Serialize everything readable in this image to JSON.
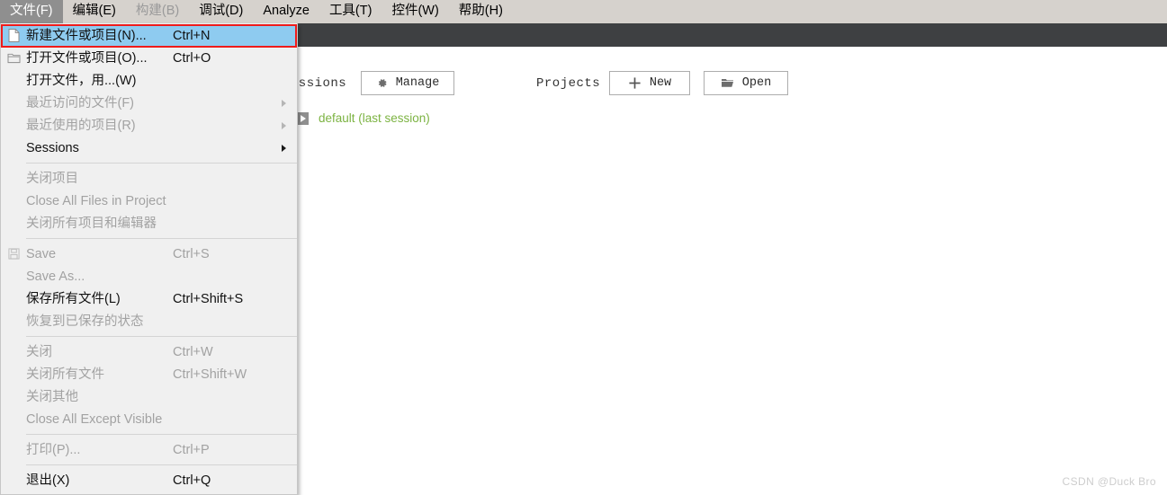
{
  "menubar": {
    "items": [
      {
        "label": "文件(F)",
        "state": "active"
      },
      {
        "label": "编辑(E)",
        "state": "normal"
      },
      {
        "label": "构建(B)",
        "state": "disabled"
      },
      {
        "label": "调试(D)",
        "state": "normal"
      },
      {
        "label": "Analyze",
        "state": "normal"
      },
      {
        "label": "工具(T)",
        "state": "normal"
      },
      {
        "label": "控件(W)",
        "state": "normal"
      },
      {
        "label": "帮助(H)",
        "state": "normal"
      }
    ]
  },
  "file_menu": {
    "groups": [
      {
        "rows": [
          {
            "icon": "new-file-icon",
            "label": "新建文件或项目(N)...",
            "shortcut": "Ctrl+N",
            "disabled": false,
            "selected": true,
            "submenu": false
          },
          {
            "icon": "open-folder-icon",
            "label": "打开文件或项目(O)...",
            "shortcut": "Ctrl+O",
            "disabled": false,
            "selected": false,
            "submenu": false
          },
          {
            "icon": "",
            "label": "打开文件，用...(W)",
            "shortcut": "",
            "disabled": false,
            "selected": false,
            "submenu": false
          },
          {
            "icon": "",
            "label": "最近访问的文件(F)",
            "shortcut": "",
            "disabled": true,
            "selected": false,
            "submenu": true
          },
          {
            "icon": "",
            "label": "最近使用的项目(R)",
            "shortcut": "",
            "disabled": true,
            "selected": false,
            "submenu": true
          },
          {
            "icon": "",
            "label": "Sessions",
            "shortcut": "",
            "disabled": false,
            "selected": false,
            "submenu": true
          }
        ]
      },
      {
        "rows": [
          {
            "icon": "",
            "label": "关闭项目",
            "shortcut": "",
            "disabled": true,
            "selected": false,
            "submenu": false
          },
          {
            "icon": "",
            "label": "Close All Files in Project",
            "shortcut": "",
            "disabled": true,
            "selected": false,
            "submenu": false
          },
          {
            "icon": "",
            "label": "关闭所有项目和编辑器",
            "shortcut": "",
            "disabled": true,
            "selected": false,
            "submenu": false
          }
        ]
      },
      {
        "rows": [
          {
            "icon": "save-icon",
            "label": "Save",
            "shortcut": "Ctrl+S",
            "disabled": true,
            "selected": false,
            "submenu": false
          },
          {
            "icon": "",
            "label": "Save As...",
            "shortcut": "",
            "disabled": true,
            "selected": false,
            "submenu": false
          },
          {
            "icon": "",
            "label": "保存所有文件(L)",
            "shortcut": "Ctrl+Shift+S",
            "disabled": false,
            "selected": false,
            "submenu": false
          },
          {
            "icon": "",
            "label": "恢复到已保存的状态",
            "shortcut": "",
            "disabled": true,
            "selected": false,
            "submenu": false
          }
        ]
      },
      {
        "rows": [
          {
            "icon": "",
            "label": "关闭",
            "shortcut": "Ctrl+W",
            "disabled": true,
            "selected": false,
            "submenu": false
          },
          {
            "icon": "",
            "label": "关闭所有文件",
            "shortcut": "Ctrl+Shift+W",
            "disabled": true,
            "selected": false,
            "submenu": false
          },
          {
            "icon": "",
            "label": "关闭其他",
            "shortcut": "",
            "disabled": true,
            "selected": false,
            "submenu": false
          },
          {
            "icon": "",
            "label": "Close All Except Visible",
            "shortcut": "",
            "disabled": true,
            "selected": false,
            "submenu": false
          }
        ]
      },
      {
        "rows": [
          {
            "icon": "",
            "label": "打印(P)...",
            "shortcut": "Ctrl+P",
            "disabled": true,
            "selected": false,
            "submenu": false
          }
        ]
      },
      {
        "rows": [
          {
            "icon": "",
            "label": "退出(X)",
            "shortcut": "Ctrl+Q",
            "disabled": false,
            "selected": false,
            "submenu": false
          }
        ]
      }
    ]
  },
  "welcome": {
    "sessions_label": "Sessions",
    "projects_label": "Projects",
    "manage_button": "Manage",
    "new_button": "New",
    "open_button": "Open",
    "session_item": "default (last session)"
  },
  "watermark": "CSDN @Duck Bro",
  "colors": {
    "menubar_bg": "#d6d2cd",
    "menubar_active_bg": "#8f8f8f",
    "toolbar_dark": "#3e4042",
    "menu_bg": "#f0f0f0",
    "selection_bg": "#8ecbf0",
    "selection_ring": "#ef1b1b",
    "session_green": "#7cb342",
    "disabled_text": "#a2a2a2"
  }
}
